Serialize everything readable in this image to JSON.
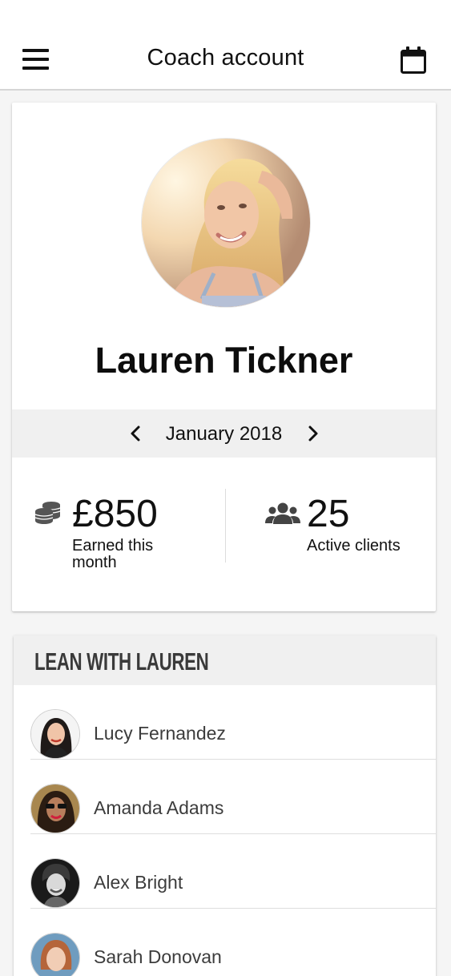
{
  "header": {
    "title": "Coach account",
    "menu_icon": "hamburger-menu-icon",
    "calendar_icon": "calendar-icon"
  },
  "profile": {
    "name": "Lauren Tickner",
    "month": "January 2018",
    "earned_value": "£850",
    "earned_label": "Earned this month",
    "clients_value": "25",
    "clients_label": "Active clients"
  },
  "group": {
    "title": "LEAN WITH LAUREN",
    "clients": [
      {
        "name": "Lucy Fernandez"
      },
      {
        "name": "Amanda Adams"
      },
      {
        "name": "Alex Bright"
      },
      {
        "name": "Sarah Donovan"
      }
    ]
  },
  "colors": {
    "background": "#f5f5f5",
    "card": "#ffffff",
    "bar": "#f0f0f0",
    "text": "#111111",
    "muted_text": "#3c3c3c",
    "icon": "#444444"
  }
}
